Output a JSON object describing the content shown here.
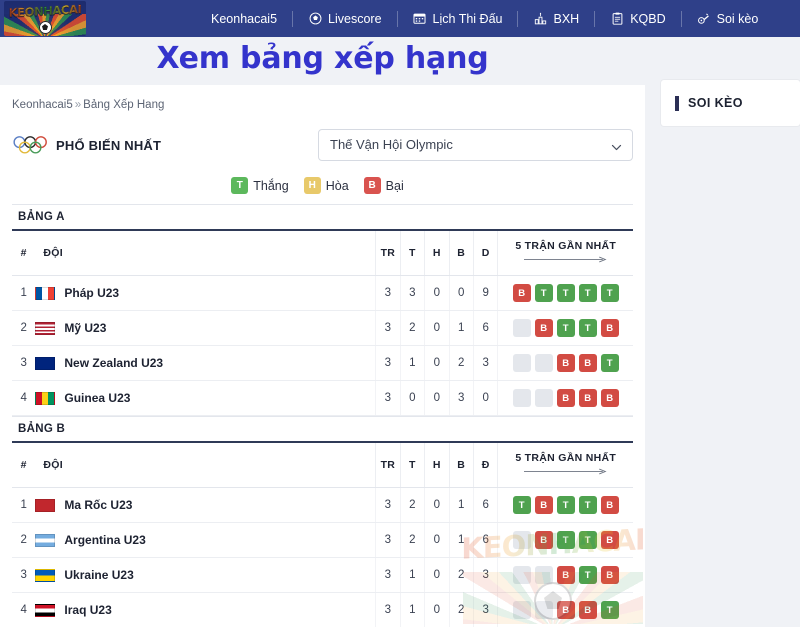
{
  "nav": {
    "logo_text": "KEONHACAI",
    "items": [
      {
        "label": "Keonhacai5",
        "icon": ""
      },
      {
        "label": "Livescore",
        "icon": "soccer-ball-icon"
      },
      {
        "label": "Lịch Thi Đấu",
        "icon": "calendar-icon"
      },
      {
        "label": "BXH",
        "icon": "bar-chart-icon"
      },
      {
        "label": "KQBD",
        "icon": "clipboard-icon"
      },
      {
        "label": "Soi kèo",
        "icon": "whistle-icon"
      }
    ]
  },
  "hero": {
    "title": "Xem bảng xếp hạng"
  },
  "breadcrumb": {
    "home": "Keonhacai5",
    "separator": "»",
    "current": "Bảng Xếp Hang"
  },
  "section": {
    "icon": "olympic-rings-icon",
    "title": "PHỔ BIẾN NHẤT",
    "select_value": "Thế Vận Hội Olympic"
  },
  "legend": [
    {
      "code": "T",
      "label": "Thắng",
      "color": "#5cb85c"
    },
    {
      "code": "H",
      "label": "Hòa",
      "color": "#e8c96a"
    },
    {
      "code": "B",
      "label": "Bại",
      "color": "#d9534f"
    }
  ],
  "groups": [
    {
      "name": "BẢNG A",
      "columns": {
        "rank": "#",
        "team": "ĐỘI",
        "tr": "TR",
        "t": "T",
        "h": "H",
        "b": "B",
        "d": "D",
        "form": "5 TRẬN GẦN NHẤT"
      },
      "rows": [
        {
          "rank": "1",
          "team": "Pháp U23",
          "flag": "france",
          "tr": "3",
          "t": "3",
          "h": "0",
          "b": "0",
          "d": "9",
          "form": [
            "B",
            "T",
            "T",
            "T",
            "T"
          ]
        },
        {
          "rank": "2",
          "team": "Mỹ U23",
          "flag": "usa",
          "tr": "3",
          "t": "2",
          "h": "0",
          "b": "1",
          "d": "6",
          "form": [
            "N",
            "B",
            "T",
            "T",
            "B"
          ]
        },
        {
          "rank": "3",
          "team": "New Zealand U23",
          "flag": "newzealand",
          "tr": "3",
          "t": "1",
          "h": "0",
          "b": "2",
          "d": "3",
          "form": [
            "N",
            "N",
            "B",
            "B",
            "T"
          ]
        },
        {
          "rank": "4",
          "team": "Guinea U23",
          "flag": "guinea",
          "tr": "3",
          "t": "0",
          "h": "0",
          "b": "3",
          "d": "0",
          "form": [
            "N",
            "N",
            "B",
            "B",
            "B"
          ]
        }
      ]
    },
    {
      "name": "BẢNG B",
      "columns": {
        "rank": "#",
        "team": "ĐỘI",
        "tr": "TR",
        "t": "T",
        "h": "H",
        "b": "B",
        "d": "Đ",
        "form": "5 TRẬN GẦN NHẤT"
      },
      "rows": [
        {
          "rank": "1",
          "team": "Ma Rốc U23",
          "flag": "morocco",
          "tr": "3",
          "t": "2",
          "h": "0",
          "b": "1",
          "d": "6",
          "form": [
            "T",
            "B",
            "T",
            "T",
            "B"
          ]
        },
        {
          "rank": "2",
          "team": "Argentina U23",
          "flag": "argentina",
          "tr": "3",
          "t": "2",
          "h": "0",
          "b": "1",
          "d": "6",
          "form": [
            "N",
            "B",
            "T",
            "T",
            "B"
          ]
        },
        {
          "rank": "3",
          "team": "Ukraine U23",
          "flag": "ukraine",
          "tr": "3",
          "t": "1",
          "h": "0",
          "b": "2",
          "d": "3",
          "form": [
            "N",
            "N",
            "B",
            "T",
            "B"
          ]
        },
        {
          "rank": "4",
          "team": "Iraq U23",
          "flag": "iraq",
          "tr": "3",
          "t": "1",
          "h": "0",
          "b": "2",
          "d": "3",
          "form": [
            "N",
            "N",
            "B",
            "B",
            "T"
          ]
        }
      ]
    }
  ],
  "rail": {
    "title": "SOI KÈO"
  },
  "watermark": {
    "text": "KEONHACAI"
  },
  "colors": {
    "nav_bg": "#2f4089",
    "title_blue": "#3434cc",
    "win": "#4fa24f",
    "loss": "#d24b43",
    "draw": "#e8c96a",
    "empty": "#e4e7ec"
  }
}
